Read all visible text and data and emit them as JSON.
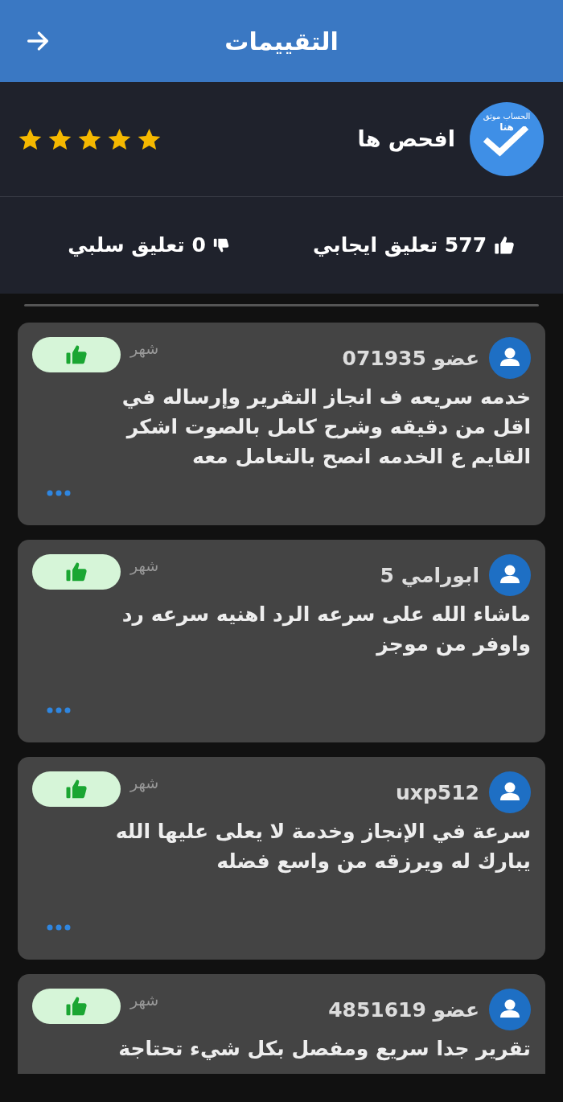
{
  "header": {
    "title": "التقييمات"
  },
  "profile": {
    "badge_text": "الحساب موثق",
    "badge_subtext": "هنا",
    "name": "افحص ها",
    "stars": 5
  },
  "stats": {
    "positive": "577 تعليق ايجابي",
    "negative": "0 تعليق سلبي"
  },
  "reviews": [
    {
      "author": "عضو 071935",
      "time": "شهر",
      "kind": "positive",
      "text": "خدمه سريعه ف انجاز التقرير وإرساله في اقل من دقيقه وشرح كامل بالصوت  اشكر القايم ع الخدمه  انصح بالتعامل معه"
    },
    {
      "author": "ابورامي 5",
      "time": "شهر",
      "kind": "positive",
      "text": "ماشاء الله على سرعه الرد اهنيه سرعه رد واوفر من موجز"
    },
    {
      "author": "uxp512",
      "time": "شهر",
      "kind": "positive",
      "text": "سرعة في الإنجاز وخدمة لا يعلى عليها  الله يبارك له ويرزقه من واسع فضله"
    },
    {
      "author": "عضو 4851619",
      "time": "شهر",
      "kind": "positive",
      "text": "تقرير جدا  سريع ومفصل بكل شيء تحتاجة"
    }
  ]
}
